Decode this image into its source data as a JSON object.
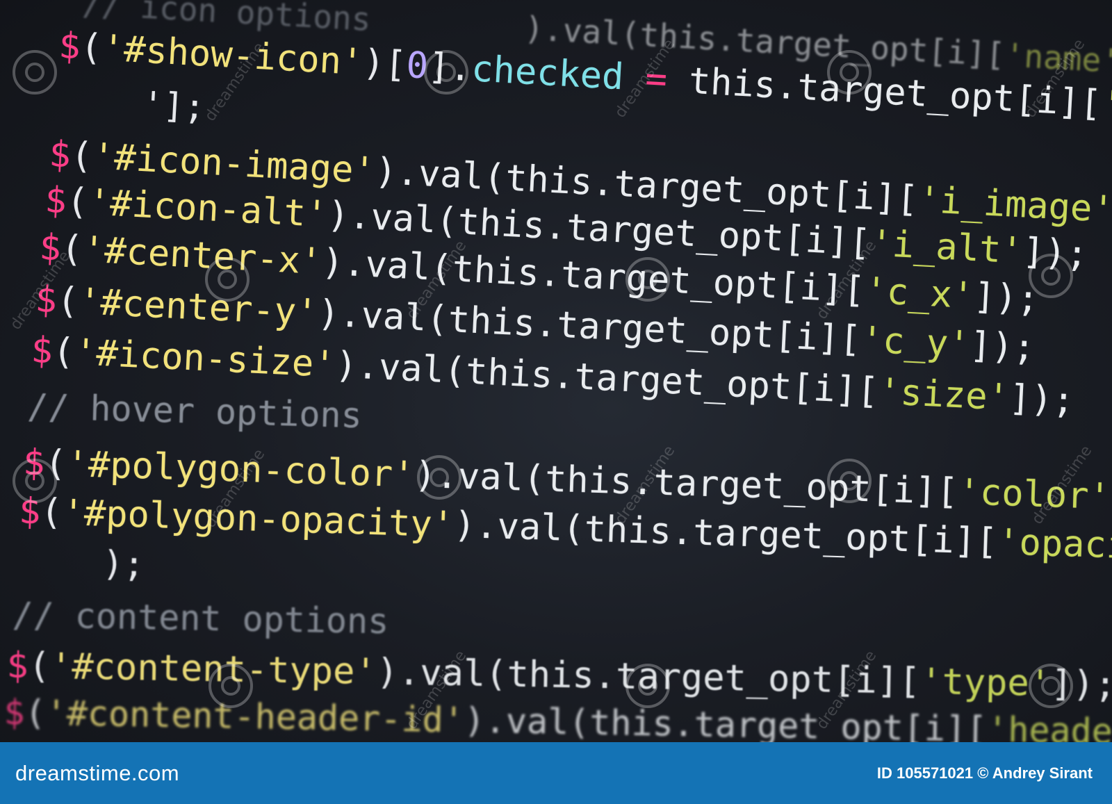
{
  "code_lines": [
    [
      {
        "c": "comment",
        "t": "// icon options"
      },
      {
        "c": "fn",
        "t": "        ).val(this.target_opt[i]["
      },
      {
        "c": "key",
        "t": "'name'"
      }
    ],
    [
      {
        "c": "dollar",
        "t": "$"
      },
      {
        "c": "punc",
        "t": "("
      },
      {
        "c": "str",
        "t": "'#show-icon'"
      },
      {
        "c": "punc",
        "t": ")["
      },
      {
        "c": "num",
        "t": "0"
      },
      {
        "c": "punc",
        "t": "]."
      },
      {
        "c": "prop",
        "t": "checked"
      },
      {
        "c": "op",
        "t": " = "
      },
      {
        "c": "fn",
        "t": "this.target_opt[i]["
      },
      {
        "c": "key",
        "t": "'label"
      }
    ],
    [
      {
        "c": "punc",
        "t": "    '];"
      }
    ],
    [
      {
        "c": "dollar",
        "t": "$"
      },
      {
        "c": "punc",
        "t": "("
      },
      {
        "c": "str",
        "t": "'#icon-image'"
      },
      {
        "c": "fn",
        "t": ").val(this.target_opt[i]["
      },
      {
        "c": "key",
        "t": "'i_image'"
      },
      {
        "c": "fn",
        "t": "]);"
      }
    ],
    [
      {
        "c": "dollar",
        "t": "$"
      },
      {
        "c": "punc",
        "t": "("
      },
      {
        "c": "str",
        "t": "'#icon-alt'"
      },
      {
        "c": "fn",
        "t": ").val(this.target_opt[i]["
      },
      {
        "c": "key",
        "t": "'i_alt'"
      },
      {
        "c": "fn",
        "t": "]);"
      }
    ],
    [
      {
        "c": "dollar",
        "t": "$"
      },
      {
        "c": "punc",
        "t": "("
      },
      {
        "c": "str",
        "t": "'#center-x'"
      },
      {
        "c": "fn",
        "t": ").val(this.target_opt[i]["
      },
      {
        "c": "key",
        "t": "'c_x'"
      },
      {
        "c": "fn",
        "t": "]);"
      }
    ],
    [
      {
        "c": "dollar",
        "t": "$"
      },
      {
        "c": "punc",
        "t": "("
      },
      {
        "c": "str",
        "t": "'#center-y'"
      },
      {
        "c": "fn",
        "t": ").val(this.target_opt[i]["
      },
      {
        "c": "key",
        "t": "'c_y'"
      },
      {
        "c": "fn",
        "t": "]);"
      }
    ],
    [
      {
        "c": "dollar",
        "t": "$"
      },
      {
        "c": "punc",
        "t": "("
      },
      {
        "c": "str",
        "t": "'#icon-size'"
      },
      {
        "c": "fn",
        "t": ").val(this.target_opt[i]["
      },
      {
        "c": "key",
        "t": "'size'"
      },
      {
        "c": "fn",
        "t": "]);"
      }
    ],
    [
      {
        "c": "comment",
        "t": "// hover options"
      }
    ],
    [
      {
        "c": "dollar",
        "t": "$"
      },
      {
        "c": "punc",
        "t": "("
      },
      {
        "c": "str",
        "t": "'#polygon-color'"
      },
      {
        "c": "fn",
        "t": ").val(this.target_opt[i]["
      },
      {
        "c": "key",
        "t": "'color'"
      },
      {
        "c": "fn",
        "t": "]);"
      }
    ],
    [
      {
        "c": "dollar",
        "t": "$"
      },
      {
        "c": "punc",
        "t": "("
      },
      {
        "c": "str",
        "t": "'#polygon-opacity'"
      },
      {
        "c": "fn",
        "t": ").val(this.target_opt[i]["
      },
      {
        "c": "key",
        "t": "'opacity'"
      }
    ],
    [
      {
        "c": "punc",
        "t": "    );"
      }
    ],
    [
      {
        "c": "comment",
        "t": "// content options"
      }
    ],
    [
      {
        "c": "dollar",
        "t": "$"
      },
      {
        "c": "punc",
        "t": "("
      },
      {
        "c": "str",
        "t": "'#content-type'"
      },
      {
        "c": "fn",
        "t": ").val(this.target_opt[i]["
      },
      {
        "c": "key",
        "t": "'type'"
      },
      {
        "c": "fn",
        "t": "]);"
      }
    ],
    [
      {
        "c": "dollar",
        "t": "$"
      },
      {
        "c": "punc",
        "t": "("
      },
      {
        "c": "str",
        "t": "'#content-header-id'"
      },
      {
        "c": "fn",
        "t": ").val(this.target_opt[i]["
      },
      {
        "c": "key",
        "t": "'header"
      }
    ]
  ],
  "watermark": {
    "text": "dreamstime",
    "icon": "dreamstime-spiral-icon"
  },
  "footer": {
    "logo_text": "dreamstime.com",
    "credit_text": "ID 105571021 © Andrey Sirant"
  },
  "colors": {
    "dollar": "#ff3d87",
    "string": "#f2e27a",
    "property": "#7fe0e8",
    "number": "#b9a6ff",
    "comment": "#8c929c",
    "key": "#c9d95a",
    "footer_bg": "#1473b5"
  }
}
